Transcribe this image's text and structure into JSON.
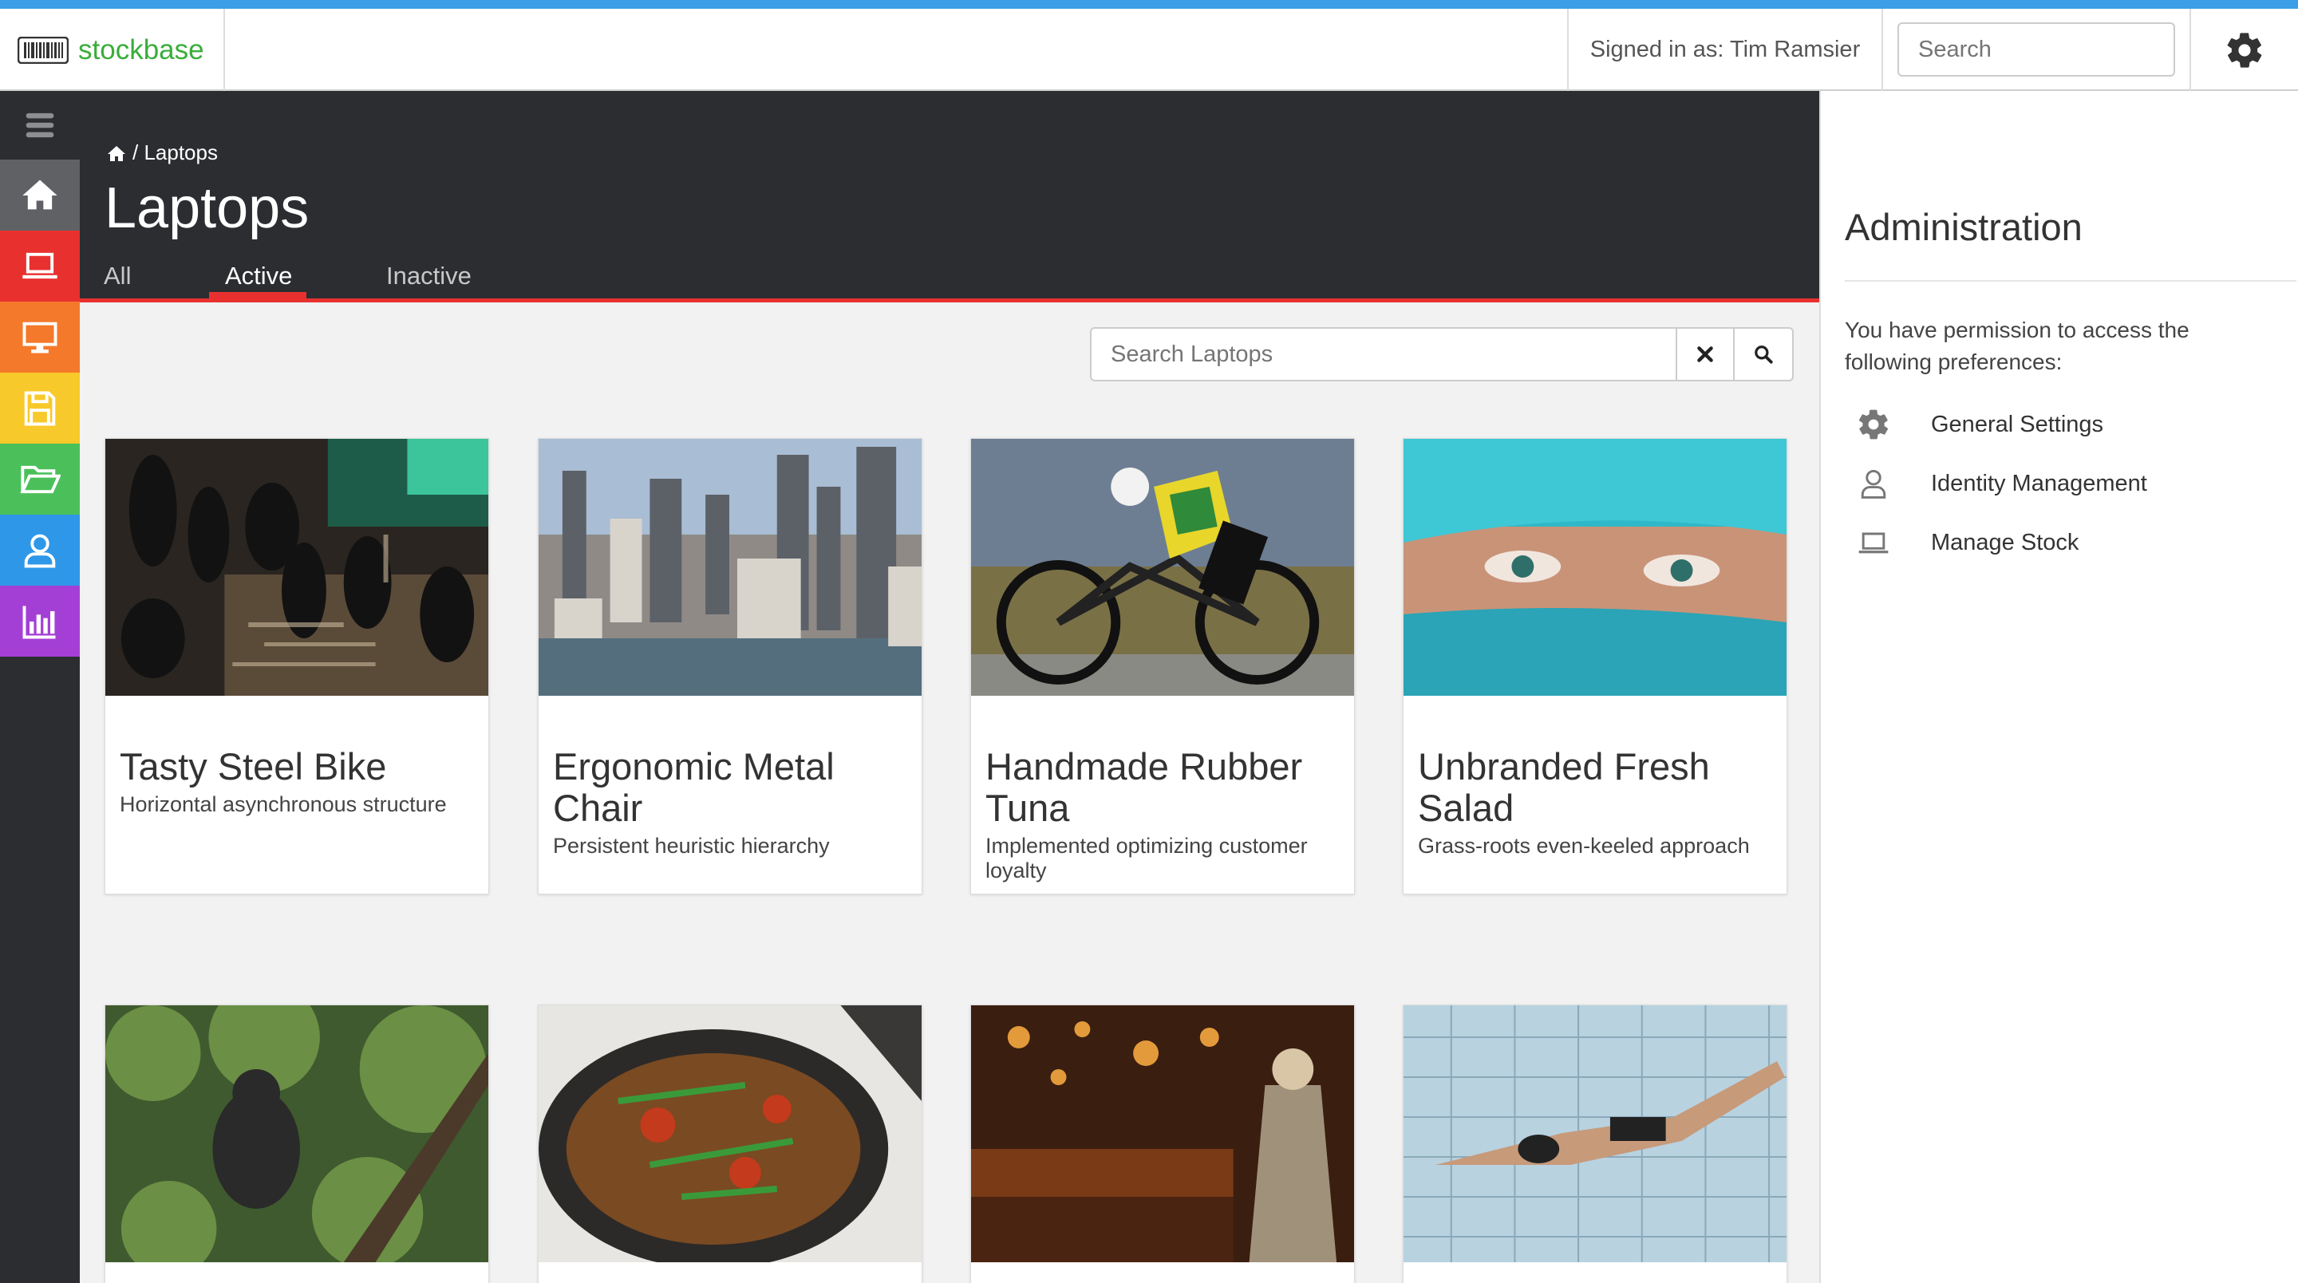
{
  "app": {
    "brand_name": "stockbase",
    "brand_color": "#3aad3a",
    "accent_color": "#e8312f",
    "topbar_accent": "#3b9ee6"
  },
  "topbar": {
    "signed_in": "Signed in as: Tim Ramsier",
    "search_placeholder": "Search",
    "settings_icon": "gear-icon"
  },
  "sidebar": {
    "items": [
      {
        "name": "menu",
        "icon": "hamburger-icon",
        "color": "#2b2d31"
      },
      {
        "name": "home",
        "icon": "home-icon",
        "color": "#5f6165"
      },
      {
        "name": "laptops",
        "icon": "laptop-icon",
        "color": "#e8312f"
      },
      {
        "name": "desktops",
        "icon": "monitor-icon",
        "color": "#f5792a"
      },
      {
        "name": "storage",
        "icon": "floppy-icon",
        "color": "#f8c92a"
      },
      {
        "name": "files",
        "icon": "folder-open-icon",
        "color": "#4bc05a"
      },
      {
        "name": "users",
        "icon": "user-icon",
        "color": "#2f97e8"
      },
      {
        "name": "reports",
        "icon": "bar-chart-icon",
        "color": "#a43fd6"
      }
    ]
  },
  "header": {
    "breadcrumb": "/ Laptops",
    "title": "Laptops",
    "tabs": [
      {
        "label": "All",
        "active": false
      },
      {
        "label": "Active",
        "active": true
      },
      {
        "label": "Inactive",
        "active": false
      }
    ]
  },
  "content": {
    "search_placeholder": "Search Laptops",
    "cards": [
      {
        "title": "Tasty Steel Bike",
        "desc": "Horizontal asynchronous structure",
        "image": "circuit-board"
      },
      {
        "title": "Ergonomic Metal Chair",
        "desc": "Persistent heuristic hierarchy",
        "image": "city-skyline"
      },
      {
        "title": "Handmade Rubber Tuna",
        "desc": "Implemented optimizing customer loyalty",
        "image": "cyclist"
      },
      {
        "title": "Unbranded Fresh Salad",
        "desc": "Grass-roots even-keeled approach",
        "image": "face-scarf"
      },
      {
        "title": "",
        "desc": "",
        "image": "gorilla"
      },
      {
        "title": "",
        "desc": "",
        "image": "food-pot"
      },
      {
        "title": "",
        "desc": "",
        "image": "bar-interior"
      },
      {
        "title": "",
        "desc": "",
        "image": "swimmer"
      }
    ]
  },
  "admin": {
    "title": "Administration",
    "text": "You have permission to access the following preferences:",
    "items": [
      {
        "label": "General Settings",
        "icon": "gear-icon"
      },
      {
        "label": "Identity Management",
        "icon": "user-icon"
      },
      {
        "label": "Manage Stock",
        "icon": "laptop-icon"
      }
    ]
  }
}
